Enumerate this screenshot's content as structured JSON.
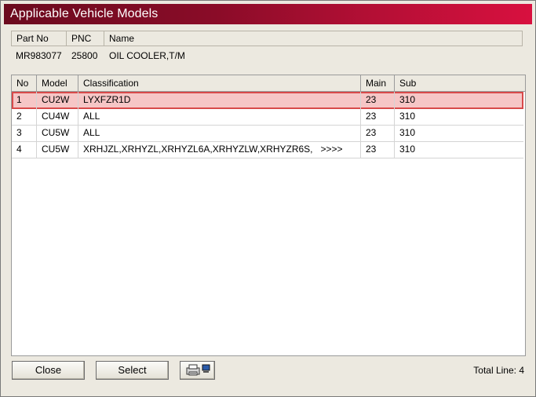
{
  "window": {
    "title": "Applicable Vehicle Models"
  },
  "part_header": {
    "columns": [
      "Part No",
      "PNC",
      "Name"
    ]
  },
  "part": {
    "part_no": "MR983077",
    "pnc": "25800",
    "name": "OIL COOLER,T/M"
  },
  "grid": {
    "columns": [
      "No",
      "Model",
      "Classification",
      "Main",
      "Sub"
    ],
    "rows": [
      {
        "no": "1",
        "model": "CU2W",
        "classification": "LYXFZR1D",
        "main": "23",
        "sub": "310",
        "selected": true
      },
      {
        "no": "2",
        "model": "CU4W",
        "classification": "ALL",
        "main": "23",
        "sub": "310",
        "selected": false
      },
      {
        "no": "3",
        "model": "CU5W",
        "classification": "ALL",
        "main": "23",
        "sub": "310",
        "selected": false
      },
      {
        "no": "4",
        "model": "CU5W",
        "classification": "XRHJZL,XRHYZL,XRHYZL6A,XRHYZLW,XRHYZR6S,   >>>>",
        "main": "23",
        "sub": "310",
        "selected": false
      }
    ]
  },
  "buttons": {
    "close": "Close",
    "select": "Select",
    "print_icon": "printer-icon"
  },
  "status": {
    "total": "Total Line: 4"
  },
  "colors": {
    "title_start": "#6b0a1e",
    "title_end": "#d8103f",
    "selection": "#f6c6c6",
    "selection_border": "#d84a4a"
  }
}
